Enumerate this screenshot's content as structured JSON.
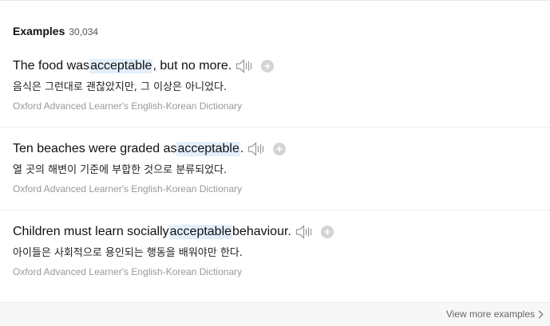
{
  "header": {
    "title": "Examples",
    "count": "30,034"
  },
  "examples": [
    {
      "before": "The food was ",
      "highlight": "acceptable",
      "after": ", but no more.",
      "translation": "음식은 그런대로 괜찮았지만, 그 이상은 아니었다.",
      "source": "Oxford Advanced Learner's English-Korean Dictionary"
    },
    {
      "before": "Ten beaches were graded as ",
      "highlight": "acceptable",
      "after": ".",
      "translation": "열 곳의 해변이 기준에 부합한 것으로 분류되었다.",
      "source": "Oxford Advanced Learner's English-Korean Dictionary"
    },
    {
      "before": "Children must learn socially ",
      "highlight": "acceptable",
      "after": " behaviour.",
      "translation": "아이들은 사회적으로 용인되는 행동을 배워야만 한다.",
      "source": "Oxford Advanced Learner's English-Korean Dictionary"
    }
  ],
  "footer": {
    "view_more_label": "View more examples"
  },
  "icons": {
    "audio": "speaker-icon",
    "add": "plus-icon",
    "view_more": "chevron-right-icon"
  },
  "colors": {
    "highlight_background": "#e3effb",
    "icon_gray": "#d4d4d4",
    "source_text": "#999999"
  }
}
